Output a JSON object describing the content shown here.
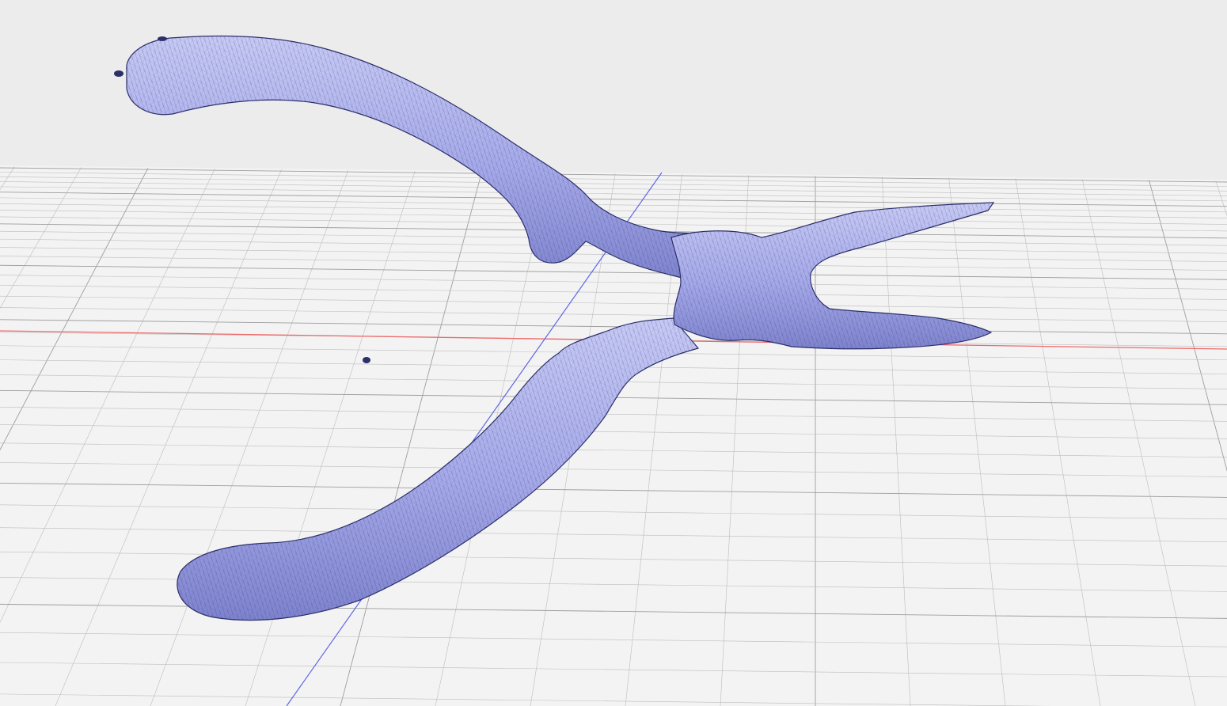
{
  "viewport": {
    "background_color": "#ececec",
    "floor_color": "#f3f3f3",
    "grid_line_color": "#bdbdbd",
    "grid_major_color": "#9e9e9e",
    "x_axis_color": "#ee6a6a",
    "y_axis_color": "#5f66e6",
    "mesh_fill_color": "#a6aaea",
    "mesh_wire_color": "#2b2f6a",
    "mesh_shadow_color": "#7f84cf",
    "mesh_highlight_color": "#c9ccf6"
  },
  "model": {
    "icon": "pliers-mesh"
  }
}
